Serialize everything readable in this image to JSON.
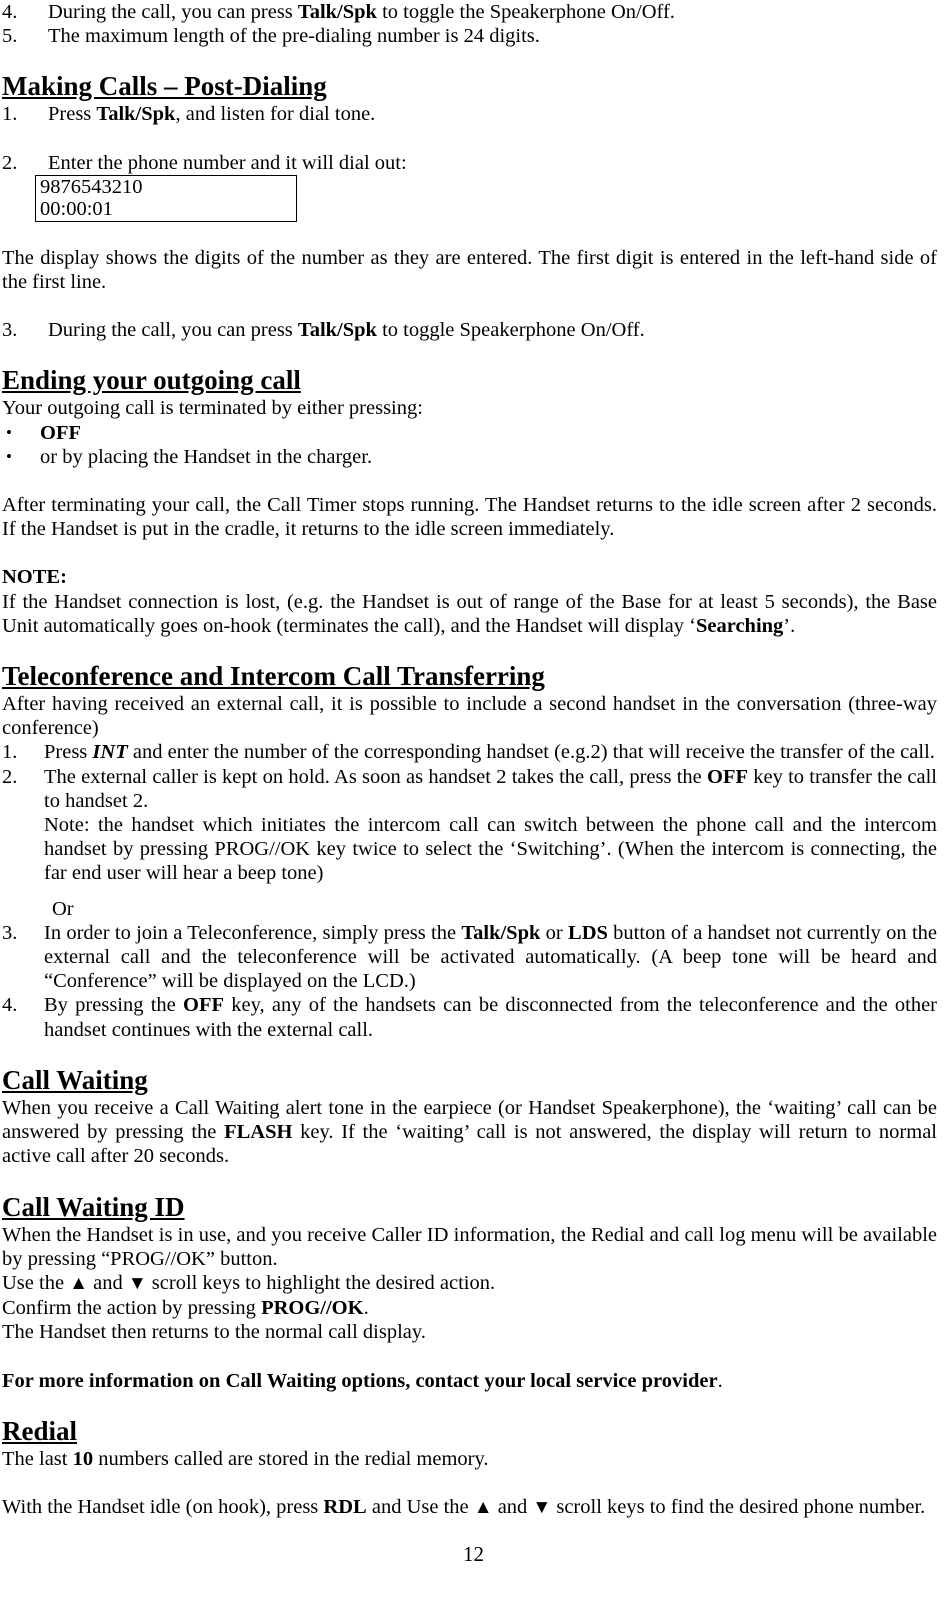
{
  "document": {
    "page_number": "12",
    "top_list": {
      "items": [
        {
          "number": "4.",
          "text_before": "During the call, you can press ",
          "bold": "Talk/Spk",
          "text_after": " to toggle the Speakerphone On/Off."
        },
        {
          "number": "5.",
          "text_before": "The maximum length of the pre-dialing number is 24 digits.",
          "bold": "",
          "text_after": ""
        }
      ]
    },
    "sections": [
      {
        "heading": "Making Calls – Post-Dialing",
        "step1_number": "1.",
        "step1_before": "Press ",
        "step1_bold": "Talk/Spk",
        "step1_after": ", and listen for dial tone.",
        "step2_number": "2.",
        "step2_text": "Enter the phone number and it will dial out:",
        "lcd_line1": "9876543210",
        "lcd_line2": "00:00:01",
        "paragraph": "The display shows the digits of the number as they are entered. The first digit is entered in the left-hand side of the first line.",
        "step3_number": "3.",
        "step3_before": "During the call, you can press ",
        "step3_bold": "Talk/Spk",
        "step3_after": " to toggle Speakerphone On/Off."
      },
      {
        "heading": "Ending your outgoing call",
        "intro": "Your outgoing call is terminated by either pressing:",
        "bullets": [
          {
            "bullet": "•",
            "text": "OFF",
            "bold": true
          },
          {
            "bullet": "•",
            "text": "or by placing the Handset in the charger.",
            "bold": false
          }
        ],
        "paragraph": "After terminating your call, the Call Timer stops running.  The Handset returns to the idle screen after 2 seconds.  If the Handset is put in the cradle, it returns to the idle screen immediately.",
        "note_label": "NOTE:",
        "note_before": "If the Handset connection is lost, (e.g. the Handset is out of range of  the Base for at least 5 seconds), the Base Unit automatically goes on-hook (terminates the call), and the Handset will display ‘",
        "note_bold": "Searching",
        "note_after": "’."
      },
      {
        "heading": "Teleconference and Intercom Call Transferring",
        "intro": "After having received an external call, it is possible to include a second handset in the conversation (three-way conference)",
        "items": [
          {
            "number": "1.",
            "before": "Press ",
            "bolditalic": "INT",
            "after": " and enter the number of the corresponding handset (e.g.2) that will receive the transfer of the call."
          },
          {
            "number": "2.",
            "before": "The external caller is kept on hold. As soon as handset 2 takes the call, press the  ",
            "bold": "OFF",
            "after": " key to transfer the call to handset 2.",
            "note": "Note: the handset which initiates the intercom call can switch between the phone call and the intercom handset by pressing PROG//OK key twice to select the ‘Switching’. (When the intercom is connecting, the far end user will hear a beep tone)"
          }
        ],
        "or_label": "Or",
        "items2": [
          {
            "number": "3.",
            "before": "In order to join a Teleconference, simply press the ",
            "bold1": "Talk/Spk",
            "mid": " or ",
            "bold2": "LDS",
            "after": " button of a handset not currently on the external call and the teleconference will be activated automatically. (A beep tone will be heard and “Conference” will be displayed on the LCD.)"
          },
          {
            "number": "4.",
            "before": "By pressing the ",
            "bold1": "OFF",
            "after": " key, any of the handsets can be disconnected from the teleconference and the other handset continues with the external call."
          }
        ]
      },
      {
        "heading": "Call Waiting",
        "before": "When you receive a Call Waiting alert tone in the earpiece (or Handset Speakerphone), the ‘waiting’ call can be answered by pressing the ",
        "bold": "FLASH",
        "after": " key. If the ‘waiting’ call is not answered, the display will return to normal active call after 20 seconds."
      },
      {
        "heading": "Call Waiting ID",
        "line1": "When the Handset is in use, and you receive Caller ID information, the Redial and call log menu will be available by pressing “PROG//OK” button.",
        "line2_a": "Use the ",
        "line2_arrow_up": "▲",
        "line2_b": " and ",
        "line2_arrow_down": "▼",
        "line2_c": " scroll keys to highlight the desired action.",
        "line3_before": "Confirm the action by pressing ",
        "line3_bold": "PROG//OK",
        "line3_after": ".",
        "line4": "The Handset then returns to the normal call display.",
        "closing_bold": "For more information on Call Waiting options, contact your local service provider",
        "closing_after": "."
      },
      {
        "heading": "Redial",
        "line1_before": "The last ",
        "line1_bold": "10",
        "line1_after": " numbers called are stored in the redial memory.",
        "line2_a": "With the Handset idle (on hook), press ",
        "line2_bold": "RDL",
        "line2_b": " and Use the ",
        "line2_arrow_up": "▲",
        "line2_c": " and ",
        "line2_arrow_down": "▼",
        "line2_d": " scroll keys to find the desired phone number."
      }
    ]
  }
}
